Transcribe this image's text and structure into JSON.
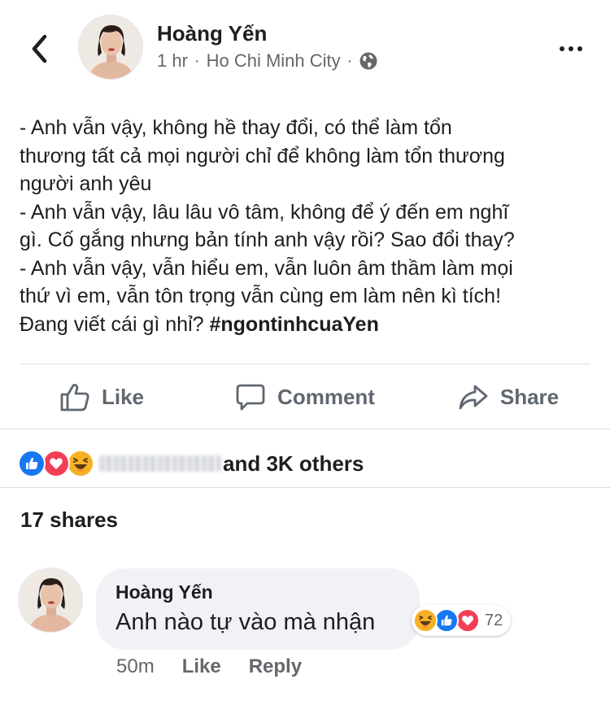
{
  "header": {
    "back_icon": "chevron-left-icon",
    "author": "Hoàng Yến",
    "time": "1 hr",
    "location": "Ho Chi Minh City",
    "separator": "·",
    "privacy_icon": "globe-icon",
    "more_icon": "more-horizontal-icon"
  },
  "post": {
    "lines": [
      "- Anh vẫn vậy, không hề thay đổi, có thể làm tổn",
      "thương tất cả mọi người chỉ để không làm tổn thương",
      "người anh yêu",
      "- Anh vẫn vậy, lâu lâu vô tâm, không để ý đến em nghĩ",
      "gì. Cố gắng nhưng bản tính anh vậy rồi? Sao đổi thay?",
      "- Anh vẫn vậy, vẫn hiểu em, vẫn luôn âm thầm làm mọi",
      "thứ vì em, vẫn tôn trọng vẫn cùng em làm nên kì tích!"
    ],
    "last_line_text": "Đang viết cái gì nhỉ? ",
    "hashtag": "#ngontinhcuaYen"
  },
  "actions": {
    "like": "Like",
    "comment": "Comment",
    "share": "Share"
  },
  "reactions": {
    "icons": [
      "like-reaction-icon",
      "love-reaction-icon",
      "haha-reaction-icon"
    ],
    "summary": "and 3K others"
  },
  "shares": "17 shares",
  "comment": {
    "author": "Hoàng Yến",
    "text": "Anh nào tự vào mà nhận",
    "reaction_count": "72",
    "time": "50m",
    "like": "Like",
    "reply": "Reply"
  },
  "colors": {
    "like_blue": "#1877f2",
    "love_red": "#f33e58",
    "haha_yellow": "#f7b125",
    "secondary_text": "#65676b",
    "bubble_bg": "#f0f2f5"
  }
}
